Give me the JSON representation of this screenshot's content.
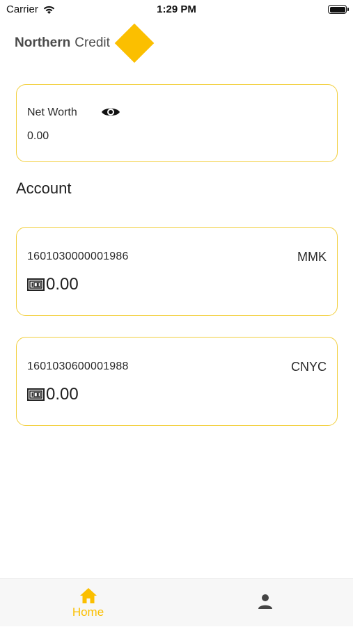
{
  "status_bar": {
    "carrier": "Carrier",
    "time": "1:29 PM",
    "wifi_icon": "wifi-icon",
    "battery_icon": "battery-icon"
  },
  "brand": {
    "name_bold": "Northern",
    "name_light": "Credit",
    "logo_color": "#fbbf00"
  },
  "net_worth": {
    "label": "Net Worth",
    "value": "0.00",
    "toggle_icon": "eye-icon"
  },
  "section": {
    "title": "Account"
  },
  "accounts": [
    {
      "number": "1601030000001986",
      "currency": "MMK",
      "balance": "0.00",
      "icon": "cash-icon"
    },
    {
      "number": "1601030600001988",
      "currency": "CNYC",
      "balance": "0.00",
      "icon": "cash-icon"
    }
  ],
  "tab_bar": {
    "tabs": [
      {
        "label": "Home",
        "icon": "home-icon",
        "active": true
      },
      {
        "label": "",
        "icon": "person-icon",
        "active": false
      }
    ]
  },
  "colors": {
    "accent": "#fbbf00",
    "card_border": "#f2cf3d"
  }
}
